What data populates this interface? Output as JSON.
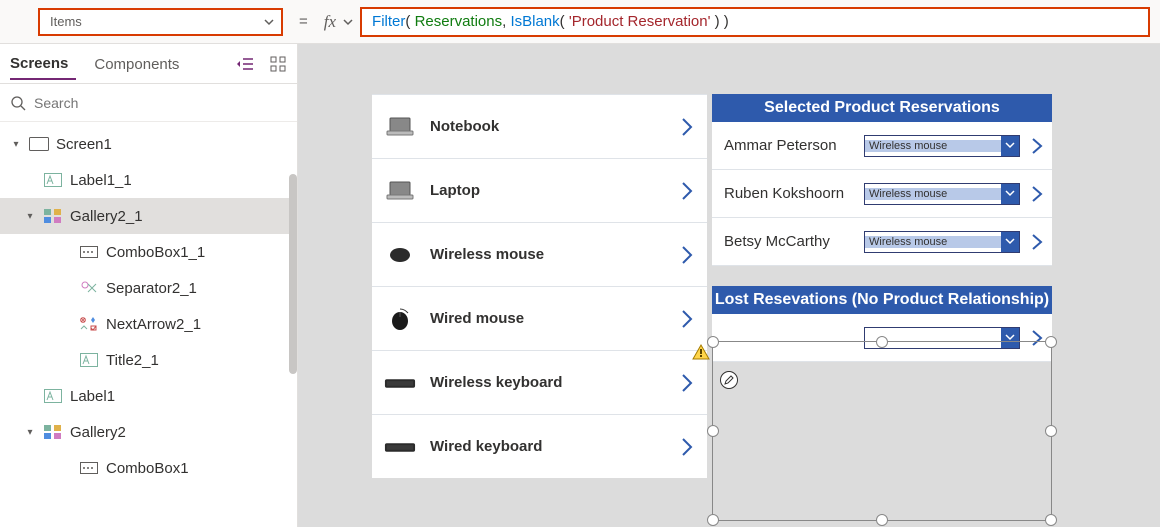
{
  "formula_bar": {
    "property": "Items",
    "tokens": {
      "filter": "Filter",
      "lp1": "( ",
      "reservations": "Reservations",
      "comma1": ", ",
      "isblank": "IsBlank",
      "lp2": "( ",
      "prodres": "'Product Reservation'",
      "rp2": " )",
      "rp1": " )"
    }
  },
  "left_panel": {
    "tabs": {
      "screens": "Screens",
      "components": "Components"
    },
    "search_placeholder": "Search",
    "tree": {
      "screen1": "Screen1",
      "label1_1": "Label1_1",
      "gallery2_1": "Gallery2_1",
      "combobox1_1": "ComboBox1_1",
      "separator2_1": "Separator2_1",
      "nextarrow2_1": "NextArrow2_1",
      "title2_1": "Title2_1",
      "label1": "Label1",
      "gallery2": "Gallery2",
      "combobox1": "ComboBox1"
    }
  },
  "canvas": {
    "products": [
      {
        "name": "Notebook",
        "thumb": "laptop"
      },
      {
        "name": "Laptop",
        "thumb": "laptop"
      },
      {
        "name": "Wireless mouse",
        "thumb": "mouse1"
      },
      {
        "name": "Wired mouse",
        "thumb": "mouse2"
      },
      {
        "name": "Wireless keyboard",
        "thumb": "keyboard"
      },
      {
        "name": "Wired keyboard",
        "thumb": "keyboard"
      }
    ],
    "selected_title": "Selected Product Reservations",
    "reservations": [
      {
        "name": "Ammar Peterson",
        "product": "Wireless mouse"
      },
      {
        "name": "Ruben Kokshoorn",
        "product": "Wireless mouse"
      },
      {
        "name": "Betsy McCarthy",
        "product": "Wireless mouse"
      }
    ],
    "lost_title": "Lost Resevations (No Product Relationship)",
    "lost_row": {
      "name": "",
      "product": ""
    }
  }
}
